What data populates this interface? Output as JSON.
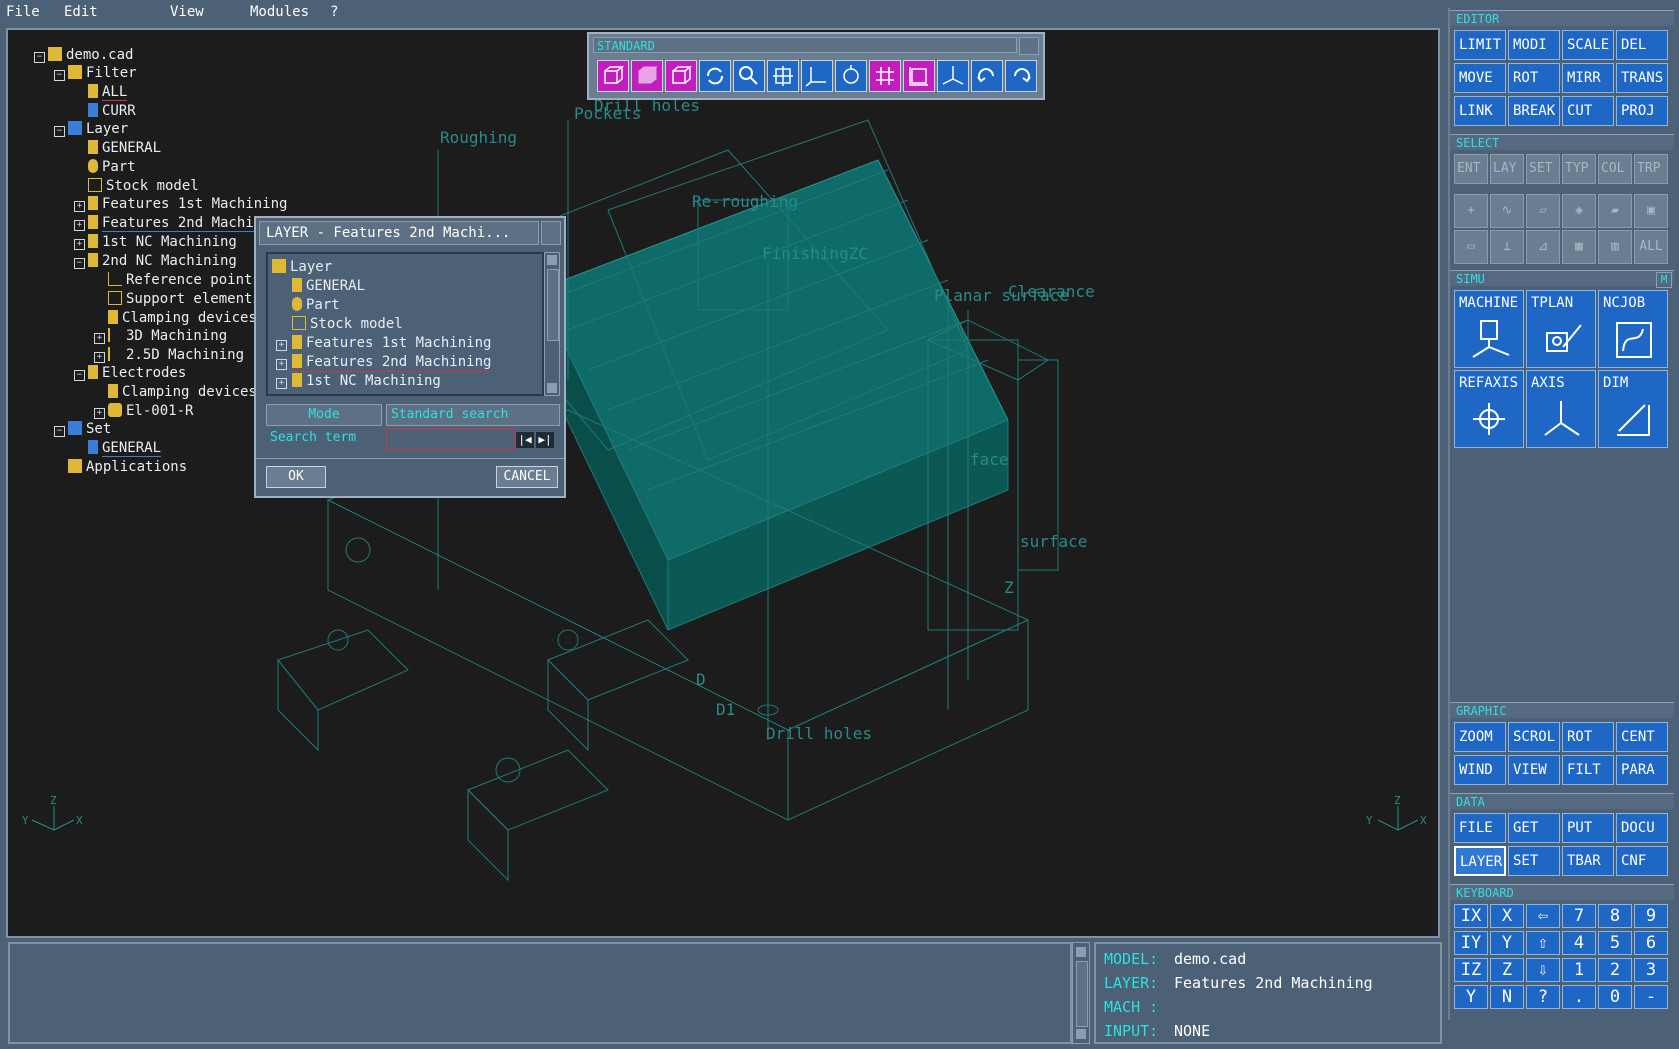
{
  "menu": {
    "file": "File",
    "edit": "Edit",
    "view": "View",
    "modules": "Modules",
    "help": "?"
  },
  "tree": {
    "root": "demo.cad",
    "filter": "Filter",
    "all": "ALL",
    "curr": "CURR",
    "layer": "Layer",
    "general": "GENERAL",
    "part": "Part",
    "stock": "Stock model",
    "feat1": "Features 1st Machining",
    "feat2": "Features 2nd Machining",
    "nc1": "1st NC Machining",
    "nc2": "2nd NC Machining",
    "refpoints": "Reference points",
    "support": "Support elements",
    "clamping1": "Clamping devices",
    "machining3d": "3D Machining",
    "machining25d": "2.5D Machining",
    "electrodes": "Electrodes",
    "clamping2": "Clamping devices",
    "el001": "El-001-R",
    "set": "Set",
    "set_general": "GENERAL",
    "applications": "Applications"
  },
  "viewport_labels": {
    "drill_top": "Drill holes",
    "pockets": "Pockets",
    "roughing": "Roughing",
    "reroughing": "Re-roughing",
    "finishing": "FinishingZC",
    "clearance": "Clearance",
    "planar": "Planar surface",
    "face": "face",
    "surface": "surface",
    "drill_bottom": "Drill holes",
    "d1": "D",
    "d2": "D1",
    "z_right": "Z"
  },
  "standard_toolbar": {
    "title": "STANDARD"
  },
  "dialog": {
    "title": "LAYER - Features 2nd Machi...",
    "list": {
      "layer": "Layer",
      "general": "GENERAL",
      "part": "Part",
      "stock": "Stock model",
      "feat1": "Features 1st Machining",
      "feat2": "Features 2nd Machining",
      "nc1": "1st NC Machining"
    },
    "mode_label": "Mode",
    "mode_value": "Standard search",
    "search_label": "Search term",
    "search_value": "",
    "ok": "OK",
    "cancel": "CANCEL"
  },
  "editor": {
    "title": "EDITOR",
    "buttons": [
      "LIMIT",
      "MODI",
      "SCALE",
      "DEL",
      "MOVE",
      "ROT",
      "MIRR",
      "TRANS",
      "LINK",
      "BREAK",
      "CUT",
      "PROJ"
    ]
  },
  "select": {
    "title": "SELECT",
    "buttons": [
      "ENT",
      "LAY",
      "SET",
      "TYP",
      "COL",
      "TRP"
    ],
    "tools_all": "ALL"
  },
  "simu": {
    "title": "SIMU",
    "mark": "M",
    "buttons": [
      "MACHINE",
      "TPLAN",
      "NCJOB",
      "REFAXIS",
      "AXIS",
      "DIM"
    ]
  },
  "graphic": {
    "title": "GRAPHIC",
    "buttons": [
      "ZOOM",
      "SCROL",
      "ROT",
      "CENT",
      "WIND",
      "VIEW",
      "FILT",
      "PARA"
    ]
  },
  "data": {
    "title": "DATA",
    "buttons": [
      "FILE",
      "GET",
      "PUT",
      "DOCU",
      "LAYER",
      "SET",
      "TBAR",
      "CNF"
    ]
  },
  "keyboard": {
    "title": "KEYBOARD",
    "keys": [
      "IX",
      "X",
      "⇦",
      "7",
      "8",
      "9",
      "IY",
      "Y",
      "⇧",
      "4",
      "5",
      "6",
      "IZ",
      "Z",
      "⇩",
      "1",
      "2",
      "3",
      "Y",
      "N",
      "?",
      ".",
      "0",
      "-"
    ]
  },
  "status": {
    "model_label": "MODEL:",
    "model_value": "demo.cad",
    "layer_label": "LAYER:",
    "layer_value": "Features 2nd Machining",
    "mach_label": "MACH :",
    "mach_value": "",
    "input_label": "INPUT:",
    "input_value": "NONE"
  },
  "colors": {
    "accent_cyan": "#2ee0e0",
    "button_blue": "#1f67c4",
    "magenta": "#c21dbd",
    "model_teal": "#1f7a78"
  }
}
